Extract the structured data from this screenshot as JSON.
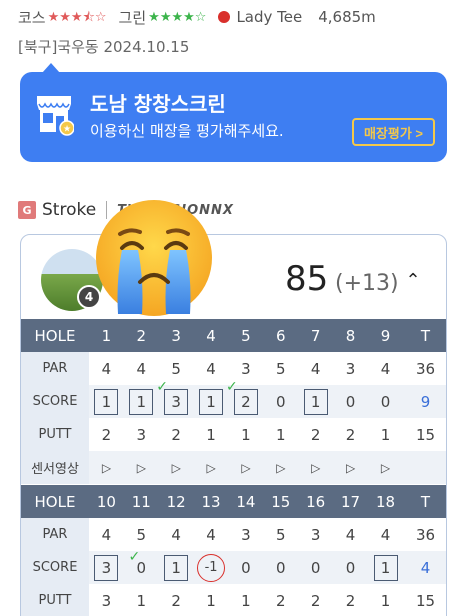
{
  "header": {
    "course_label": "코스",
    "course_stars": [
      1,
      1,
      1,
      0.5,
      0
    ],
    "green_label": "그린",
    "green_stars": [
      1,
      1,
      1,
      1,
      0
    ],
    "tee": "Lady Tee",
    "distance": "4,685m"
  },
  "course_line": "[북구]국우동 2024.10.15",
  "banner": {
    "title": "도남 창창스크린",
    "subtitle": "이용하신 매장을 평가해주세요.",
    "button": "매장평가 >"
  },
  "mode": {
    "badge": "G",
    "label": "Stroke",
    "brand": "TWOVISIONNX"
  },
  "scorecard": {
    "avatar_badge": "4",
    "total": "85",
    "total_diff": "(+13)",
    "collapse": "^",
    "front": {
      "hole_label": "HOLE",
      "holes": [
        "1",
        "2",
        "3",
        "4",
        "5",
        "6",
        "7",
        "8",
        "9"
      ],
      "hole_total": "T",
      "par_label": "PAR",
      "par": [
        "4",
        "4",
        "5",
        "4",
        "3",
        "5",
        "4",
        "3",
        "4"
      ],
      "par_total": "36",
      "score_label": "SCORE",
      "score": [
        "1",
        "1",
        "3",
        "1",
        "2",
        "0",
        "1",
        "0",
        "0"
      ],
      "score_total": "9",
      "putt_label": "PUTT",
      "putt": [
        "2",
        "3",
        "2",
        "1",
        "1",
        "1",
        "2",
        "2",
        "1"
      ],
      "putt_total": "15",
      "sensor_label": "센서영상"
    },
    "back": {
      "hole_label": "HOLE",
      "holes": [
        "10",
        "11",
        "12",
        "13",
        "14",
        "15",
        "16",
        "17",
        "18"
      ],
      "hole_total": "T",
      "par_label": "PAR",
      "par": [
        "4",
        "5",
        "4",
        "4",
        "3",
        "5",
        "3",
        "4",
        "4"
      ],
      "par_total": "36",
      "score_label": "SCORE",
      "score": [
        "3",
        "0",
        "1",
        "-1",
        "0",
        "0",
        "0",
        "0",
        "1"
      ],
      "score_total": "4",
      "putt_label": "PUTT",
      "putt": [
        "3",
        "1",
        "2",
        "1",
        "1",
        "2",
        "2",
        "2",
        "1"
      ],
      "putt_total": "15"
    }
  }
}
